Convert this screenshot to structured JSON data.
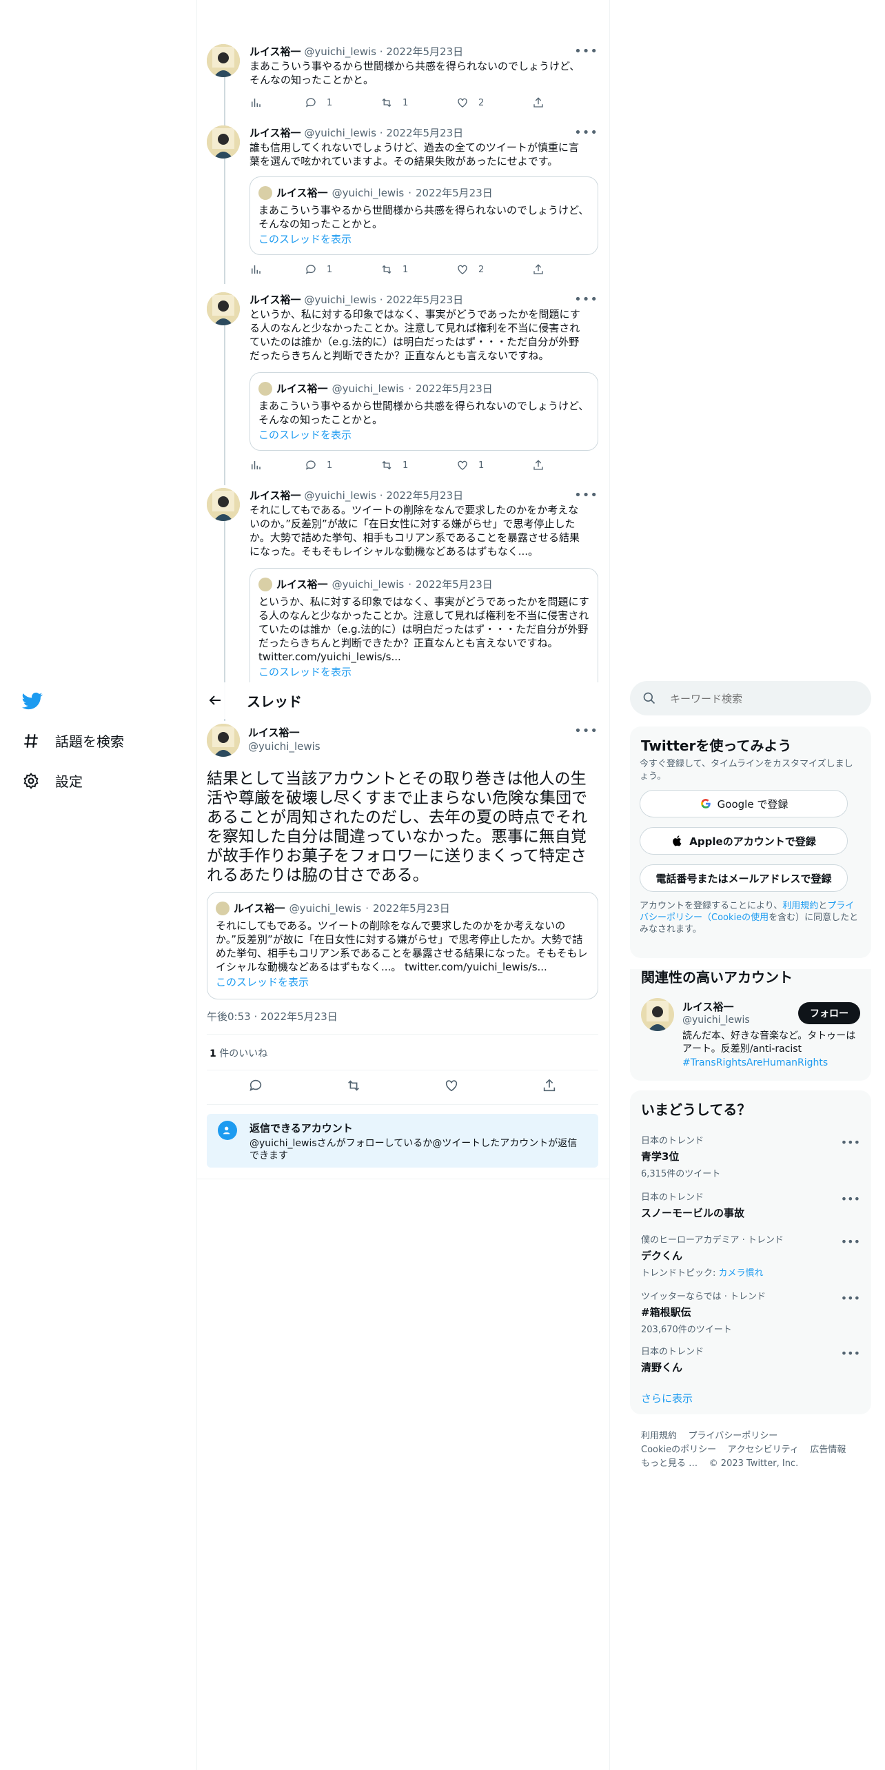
{
  "author": {
    "name": "ルイス裕一",
    "handle": "@yuichi_lewis"
  },
  "thread": [
    {
      "date": "2022年5月23日",
      "text": "まあこういう事やるから世間様から共感を得られないのでしょうけど、そんなの知ったことかと。",
      "replies": "1",
      "retweets": "1",
      "likes": "2"
    },
    {
      "date": "2022年5月23日",
      "text": "誰も信用してくれないでしょうけど、過去の全てのツイートが慎重に言葉を選んで呟かれていますよ。その結果失敗があったにせよです。",
      "quote": {
        "date": "2022年5月23日",
        "text": "まあこういう事やるから世間様から共感を得られないのでしょうけど、そんなの知ったことかと。",
        "link": "このスレッドを表示"
      },
      "replies": "1",
      "retweets": "1",
      "likes": "2"
    },
    {
      "date": "2022年5月23日",
      "text": "というか、私に対する印象ではなく、事実がどうであったかを問題にする人のなんと少なかったことか。注意して見れば権利を不当に侵害されていたのは誰か（e.g.法的に）は明白だったはず・・・ただ自分が外野だったらきちんと判断できたか？正直なんとも言えないですね。",
      "quote": {
        "date": "2022年5月23日",
        "text": "まあこういう事やるから世間様から共感を得られないのでしょうけど、そんなの知ったことかと。",
        "link": "このスレッドを表示"
      },
      "replies": "1",
      "retweets": "1",
      "likes": "1"
    },
    {
      "date": "2022年5月23日",
      "text": "それにしてもである。ツイートの削除をなんで要求したのかをか考えないのか。”反差別”が故に「在日女性に対する嫌がらせ」で思考停止したか。大勢で詰めた挙句、相手もコリアン系であることを暴露させる結果になった。そもそもレイシャルな動機などあるはずもなく...。",
      "quote": {
        "date": "2022年5月23日",
        "text": "というか、私に対する印象ではなく、事実がどうであったかを問題にする人のなんと少なかったことか。注意して見れば権利を不当に侵害されていたのは誰か（e.g.法的に）は明白だったはず・・・ただ自分が外野だったらきちんと判断できたか？正直なんとも言えないですね。 twitter.com/yuichi_lewis/s...",
        "link": "このスレッドを表示"
      }
    }
  ],
  "header": {
    "title": "スレッド"
  },
  "nav": {
    "explore": "話題を検索",
    "settings": "設定"
  },
  "main_tweet": {
    "text": "結果として当該アカウントとその取り巻きは他人の生活や尊厳を破壊し尽くすまで止まらない危険な集団であることが周知されたのだし、去年の夏の時点でそれを察知した自分は間違っていなかった。悪事に無自覚が故手作りお菓子をフォロワーに送りまくって特定されるあたりは脇の甘さである。",
    "quote": {
      "date": "2022年5月23日",
      "text": "それにしてもである。ツイートの削除をなんで要求したのかをか考えないのか。”反差別”が故に「在日女性に対する嫌がらせ」で思考停止したか。大勢で詰めた挙句、相手もコリアン系であることを暴露させる結果になった。そもそもレイシャルな動機などあるはずもなく...。 twitter.com/yuichi_lewis/s...",
      "link": "このスレッドを表示"
    },
    "timestamp": "午後0:53 · 2022年5月23日",
    "likes_count": "1",
    "likes_label": "件のいいね",
    "reply_title": "返信できるアカウント",
    "reply_desc": "@yuichi_lewisさんがフォローしているか@ツイートしたアカウントが返信できます"
  },
  "search": {
    "placeholder": "キーワード検索"
  },
  "signup": {
    "title": "Twitterを使ってみよう",
    "desc": "今すぐ登録して、タイムラインをカスタマイズしましょう。",
    "google": "Google で登録",
    "apple": "Appleのアカウントで登録",
    "phone": "電話番号またはメールアドレスで登録",
    "legal_prefix": "アカウントを登録することにより、",
    "terms": "利用規約",
    "and": "と",
    "privacy": "プライバシーポリシー",
    "cookie": "（Cookieの使用",
    "legal_suffix": "を含む）に同意したとみなされます。"
  },
  "related": {
    "title": "関連性の高いアカウント",
    "name": "ルイス裕一",
    "handle": "@yuichi_lewis",
    "follow": "フォロー",
    "bio": "読んだ本、好きな音楽など。タトゥーはアート。反差別/anti-racist",
    "hashtag": "#TransRightsAreHumanRights"
  },
  "trends": {
    "title": "いまどうしてる？",
    "items": [
      {
        "category": "日本のトレンド",
        "title": "青学3位",
        "count": "6,315件のツイート"
      },
      {
        "category": "日本のトレンド",
        "title": "スノーモービルの事故",
        "count": ""
      },
      {
        "category": "僕のヒーローアカデミア · トレンド",
        "title": "デクくん",
        "count_prefix": "トレンドトピック: ",
        "count_link": "カメラ慣れ"
      },
      {
        "category": "ツイッターならでは · トレンド",
        "title": "#箱根駅伝",
        "count": "203,670件のツイート"
      },
      {
        "category": "日本のトレンド",
        "title": "清野くん",
        "count": ""
      }
    ],
    "more": "さらに表示"
  },
  "footer": {
    "terms": "利用規約",
    "privacy": "プライバシーポリシー",
    "cookie": "Cookieのポリシー",
    "accessibility": "アクセシビリティ",
    "ads": "広告情報",
    "more": "もっと見る …",
    "copyright": "© 2023 Twitter, Inc."
  },
  "colors": {
    "accent": "#1d9bf0",
    "text": "#0f1419",
    "secondary": "#536471",
    "border": "#cfd9de"
  }
}
